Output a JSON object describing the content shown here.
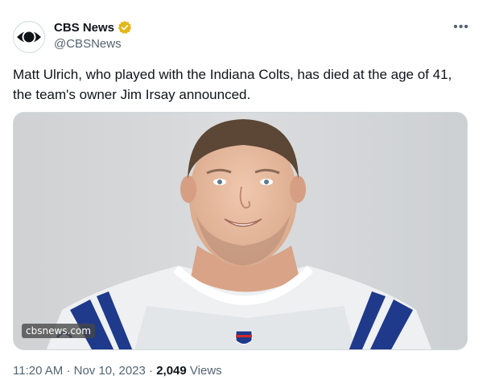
{
  "author": {
    "name": "CBS News",
    "handle": "@CBSNews",
    "avatar_icon": "cbs-eye-logo-icon",
    "verified_icon": "gold-verified-badge-icon",
    "verified_color": "#e2b719"
  },
  "more_icon": "more-options-icon",
  "tweet": {
    "text": "Matt Ulrich, who played with the Indiana Colts, has died at the age of 41, the team's owner Jim Irsay announced."
  },
  "media": {
    "watermark": "cbsnews.com",
    "background_color": "#d4d6d8"
  },
  "meta": {
    "time": "11:20 AM",
    "separator": "·",
    "date": "Nov 10, 2023",
    "views_count": "2,049",
    "views_label": "Views"
  },
  "colors": {
    "text_primary": "#0f1419",
    "text_secondary": "#536471",
    "border": "#cfd9de",
    "colts_blue": "#1f3a8a"
  }
}
